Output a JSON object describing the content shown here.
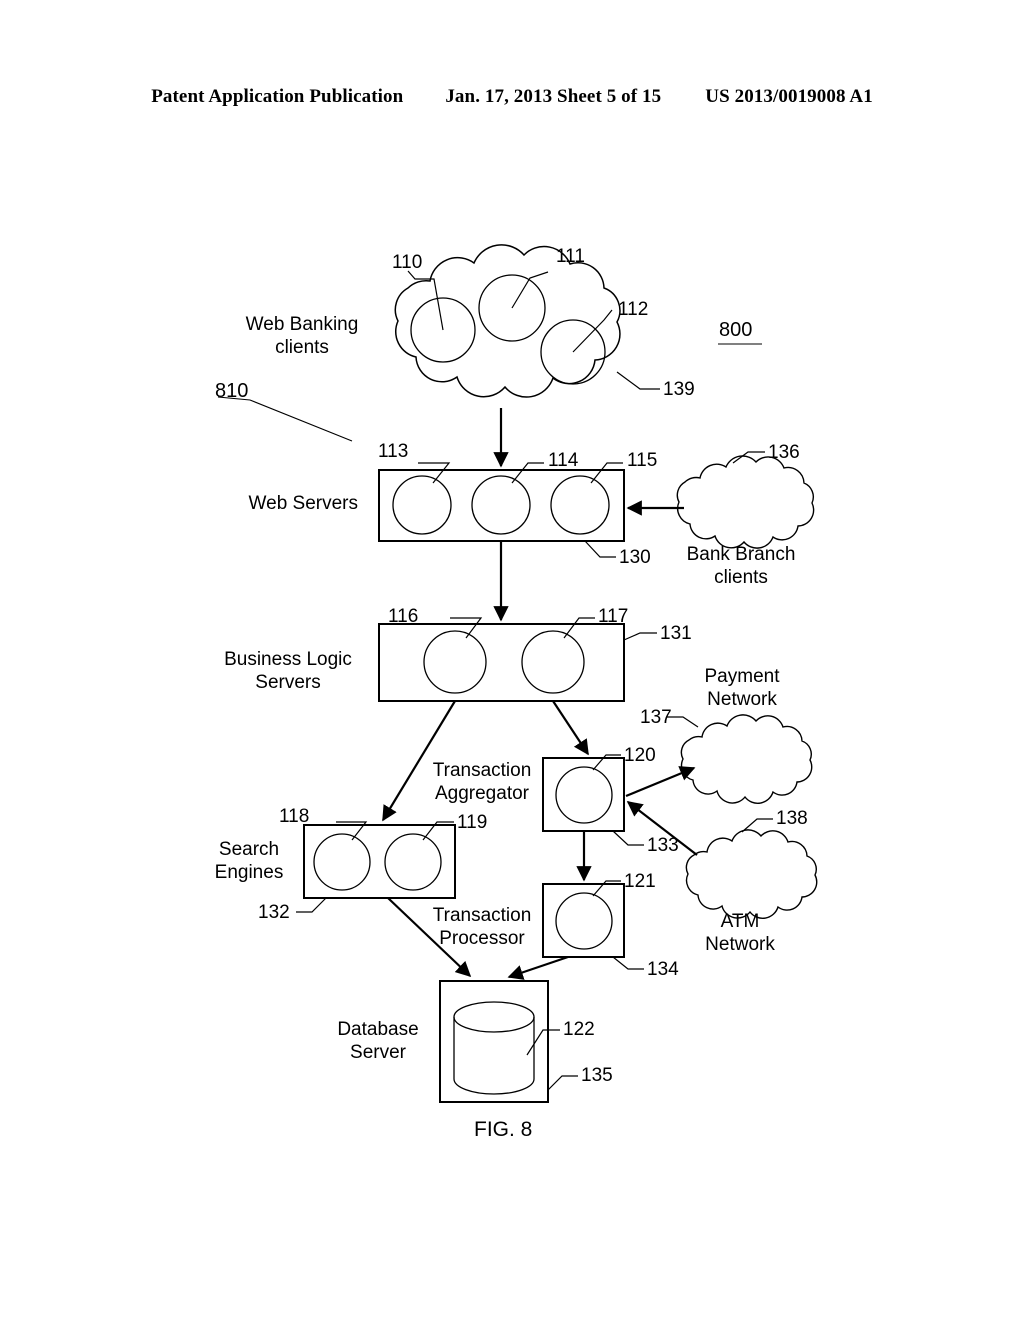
{
  "header": {
    "left": "Patent Application Publication",
    "middle": "Jan. 17, 2013  Sheet 5 of 15",
    "right": "US 2013/0019008 A1"
  },
  "figure": {
    "caption": "FIG. 8",
    "system_number": "800",
    "subsystem_number": "810"
  },
  "nodes": {
    "web_banking_clients": {
      "label": "Web Banking\nclients",
      "cloud_ref": "139",
      "items": [
        "110",
        "111",
        "112"
      ]
    },
    "web_servers": {
      "label": "Web Servers",
      "box_ref": "130",
      "items": [
        "113",
        "114",
        "115"
      ]
    },
    "bank_branch_clients": {
      "label": "Bank Branch\nclients",
      "cloud_ref": "136"
    },
    "business_logic_servers": {
      "label": "Business Logic\nServers",
      "box_ref": "131",
      "items": [
        "116",
        "117"
      ]
    },
    "payment_network": {
      "label": "Payment\nNetwork",
      "cloud_ref": "137"
    },
    "atm_network": {
      "label": "ATM\nNetwork",
      "cloud_ref": "138"
    },
    "transaction_aggregator": {
      "label": "Transaction\nAggregator",
      "box_ref": "133",
      "items": [
        "120"
      ]
    },
    "transaction_processor": {
      "label": "Transaction\nProcessor",
      "box_ref": "134",
      "items": [
        "121"
      ]
    },
    "search_engines": {
      "label": "Search\nEngines",
      "box_ref": "132",
      "items": [
        "118",
        "119"
      ]
    },
    "database_server": {
      "label": "Database\nServer",
      "box_ref": "135",
      "items": [
        "122"
      ]
    }
  },
  "ref_numbers": {
    "n110": "110",
    "n111": "111",
    "n112": "112",
    "n113": "113",
    "n114": "114",
    "n115": "115",
    "n116": "116",
    "n117": "117",
    "n118": "118",
    "n119": "119",
    "n120": "120",
    "n121": "121",
    "n122": "122",
    "n130": "130",
    "n131": "131",
    "n132": "132",
    "n133": "133",
    "n134": "134",
    "n135": "135",
    "n136": "136",
    "n137": "137",
    "n138": "138",
    "n139": "139",
    "n800": "800",
    "n810": "810"
  },
  "colors": {
    "ink": "#000000",
    "paper": "#ffffff"
  }
}
